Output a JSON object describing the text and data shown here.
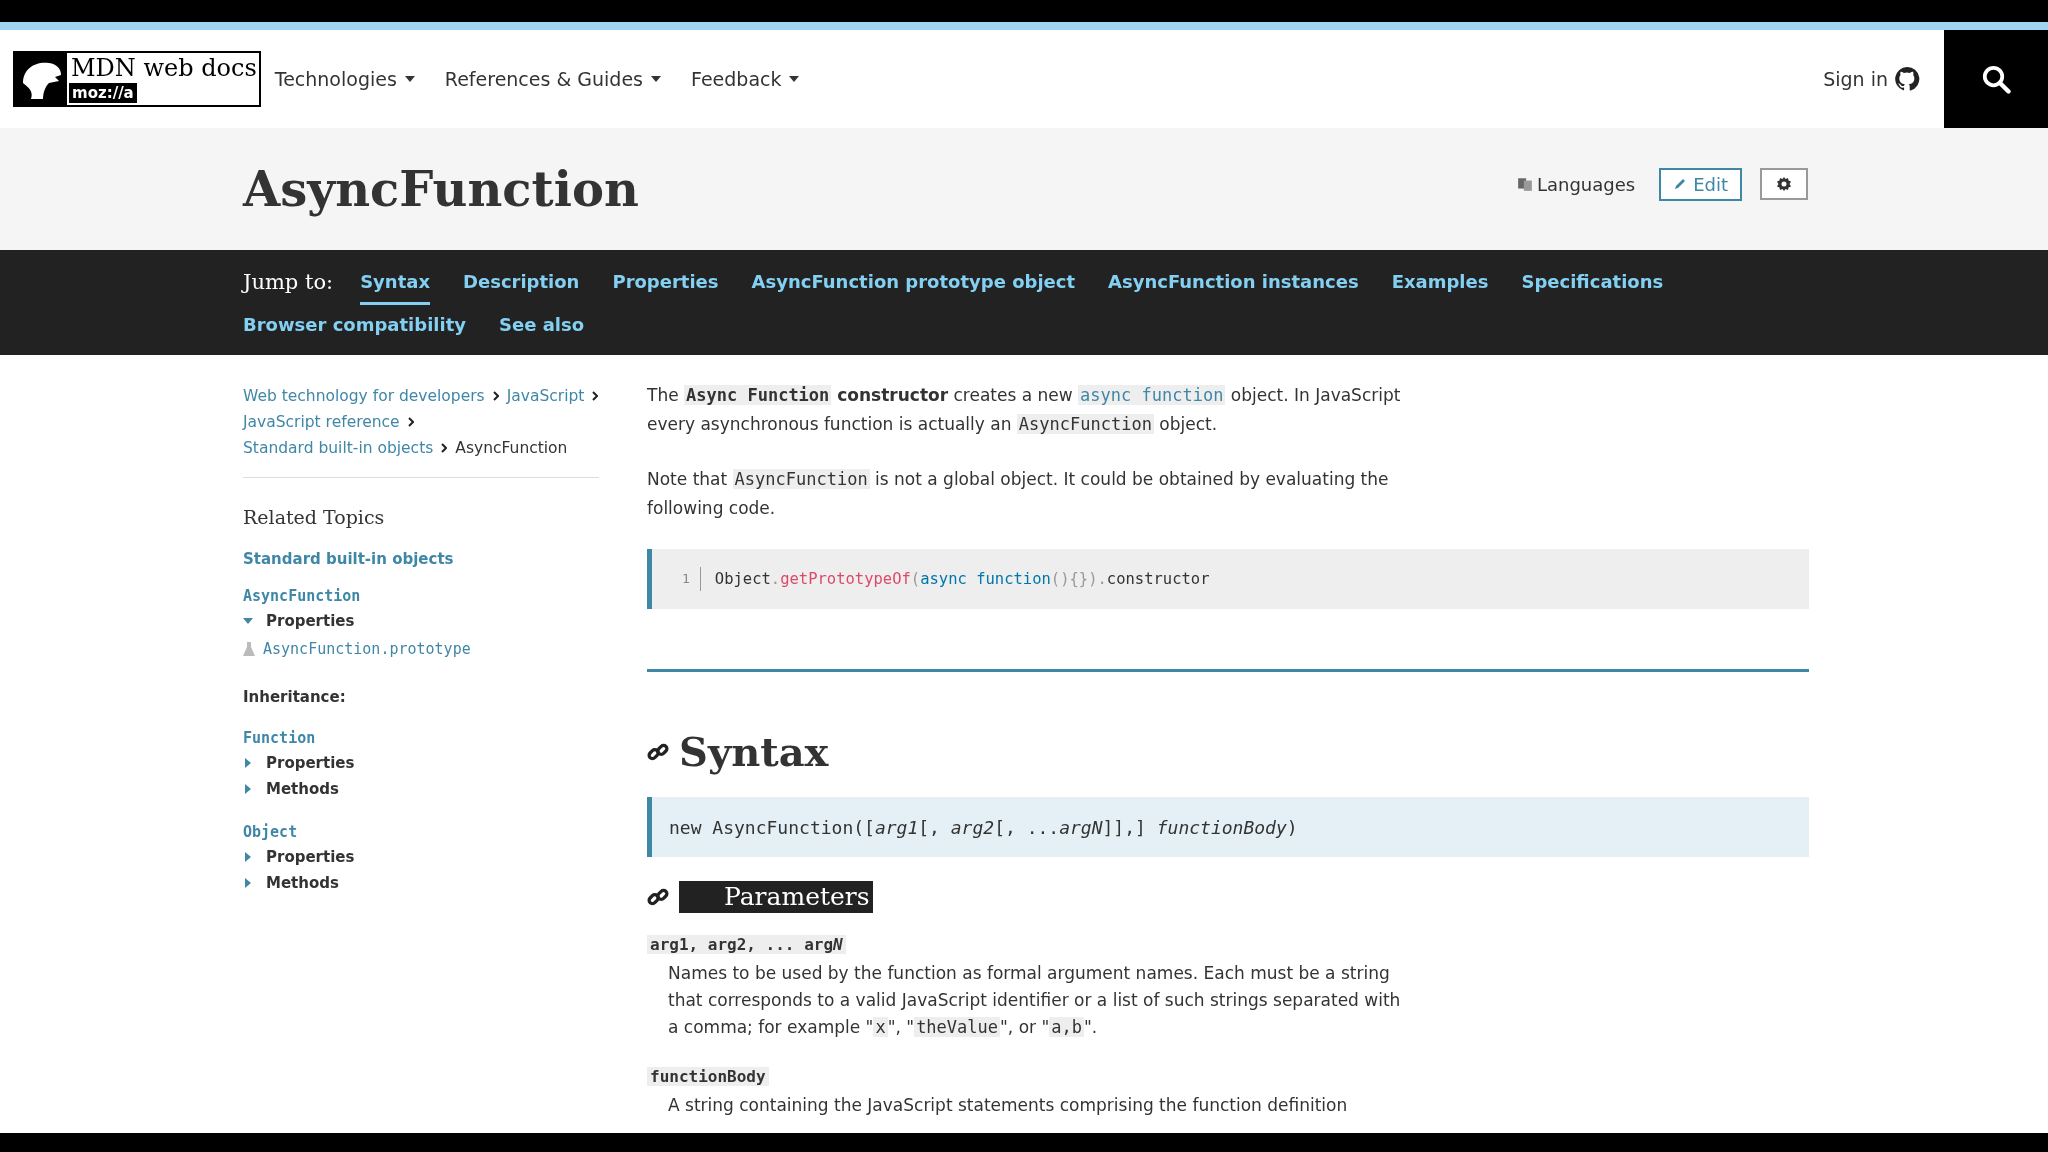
{
  "top_nav": {
    "logo": {
      "title": "MDN web docs",
      "sub": "moz://a"
    },
    "menus": [
      {
        "label": "Technologies"
      },
      {
        "label": "References & Guides"
      },
      {
        "label": "Feedback"
      }
    ],
    "sign_in": "Sign in"
  },
  "page_header": {
    "title": "AsyncFunction",
    "languages": "Languages",
    "edit": "Edit"
  },
  "jump_to": {
    "label": "Jump to:",
    "links": [
      {
        "label": "Syntax",
        "selected": true
      },
      {
        "label": "Description",
        "selected": false
      },
      {
        "label": "Properties",
        "selected": false
      },
      {
        "label": "AsyncFunction prototype object",
        "selected": false
      },
      {
        "label": "AsyncFunction instances",
        "selected": false
      },
      {
        "label": "Examples",
        "selected": false
      },
      {
        "label": "Specifications",
        "selected": false
      },
      {
        "label": "Browser compatibility",
        "selected": false
      },
      {
        "label": "See also",
        "selected": false
      }
    ]
  },
  "breadcrumbs": [
    {
      "label": "Web technology for developers",
      "current": false
    },
    {
      "label": "JavaScript",
      "current": false
    },
    {
      "label": "JavaScript reference",
      "current": false
    },
    {
      "label": "Standard built-in objects",
      "current": false
    },
    {
      "label": "AsyncFunction",
      "current": true
    }
  ],
  "related_topics": {
    "title": "Related Topics",
    "top_link": "Standard built-in objects",
    "entries": [
      {
        "kind": "group",
        "name": "AsyncFunction",
        "items": [
          {
            "label": "Properties",
            "expanded": true,
            "children": [
              {
                "label": "AsyncFunction.prototype",
                "experimental": true
              }
            ]
          }
        ]
      },
      {
        "kind": "label",
        "text": "Inheritance:"
      },
      {
        "kind": "group",
        "name": "Function",
        "items": [
          {
            "label": "Properties",
            "expanded": false
          },
          {
            "label": "Methods",
            "expanded": false
          }
        ]
      },
      {
        "kind": "group",
        "name": "Object",
        "items": [
          {
            "label": "Properties",
            "expanded": false
          },
          {
            "label": "Methods",
            "expanded": false
          }
        ]
      }
    ]
  },
  "intro": [
    [
      {
        "text": "The ",
        "kind": "text"
      },
      {
        "text": "Async Function",
        "kind": "code-bold"
      },
      {
        "text": " constructor",
        "kind": "bold"
      },
      {
        "text": " creates a new ",
        "kind": "text"
      },
      {
        "text": "async function",
        "kind": "code-link"
      },
      {
        "text": " object. In JavaScript every asynchronous function is actually an ",
        "kind": "text"
      },
      {
        "text": "AsyncFunction",
        "kind": "code"
      },
      {
        "text": " object.",
        "kind": "text"
      }
    ],
    [
      {
        "text": "Note that ",
        "kind": "text"
      },
      {
        "text": "AsyncFunction",
        "kind": "code"
      },
      {
        "text": " is not a global object. It could be obtained by evaluating the following code.",
        "kind": "text"
      }
    ]
  ],
  "code_example": {
    "line_number": "1",
    "tokens": [
      {
        "text": "Object",
        "kind": "plain"
      },
      {
        "text": ".",
        "kind": "punct"
      },
      {
        "text": "getPrototypeOf",
        "kind": "func"
      },
      {
        "text": "(",
        "kind": "punct"
      },
      {
        "text": "async function",
        "kind": "keyword"
      },
      {
        "text": "(){}).",
        "kind": "punct"
      },
      {
        "text": "constructor",
        "kind": "plain"
      }
    ]
  },
  "syntax": {
    "heading": "Syntax",
    "signature": "new AsyncFunction([*arg1*[, *arg2*[, ...*argN*]],] *functionBody*)"
  },
  "parameters": {
    "heading": "Parameters",
    "items": [
      {
        "term": [
          {
            "text": "arg1, arg2, ... arg",
            "kind": "text"
          },
          {
            "text": "N",
            "kind": "italic"
          }
        ],
        "description": [
          {
            "text": "Names to be used by the function as formal argument names. Each must be a string that corresponds to a valid JavaScript identifier or a list of such strings separated with a comma; for example \"",
            "kind": "text"
          },
          {
            "text": "x",
            "kind": "code"
          },
          {
            "text": "\", \"",
            "kind": "text"
          },
          {
            "text": "theValue",
            "kind": "code"
          },
          {
            "text": "\", or \"",
            "kind": "text"
          },
          {
            "text": "a,b",
            "kind": "code"
          },
          {
            "text": "\".",
            "kind": "text"
          }
        ]
      },
      {
        "term": [
          {
            "text": "functionBody",
            "kind": "text"
          }
        ],
        "description": [
          {
            "text": "A string containing the JavaScript statements comprising the function definition",
            "kind": "text"
          }
        ]
      }
    ]
  }
}
